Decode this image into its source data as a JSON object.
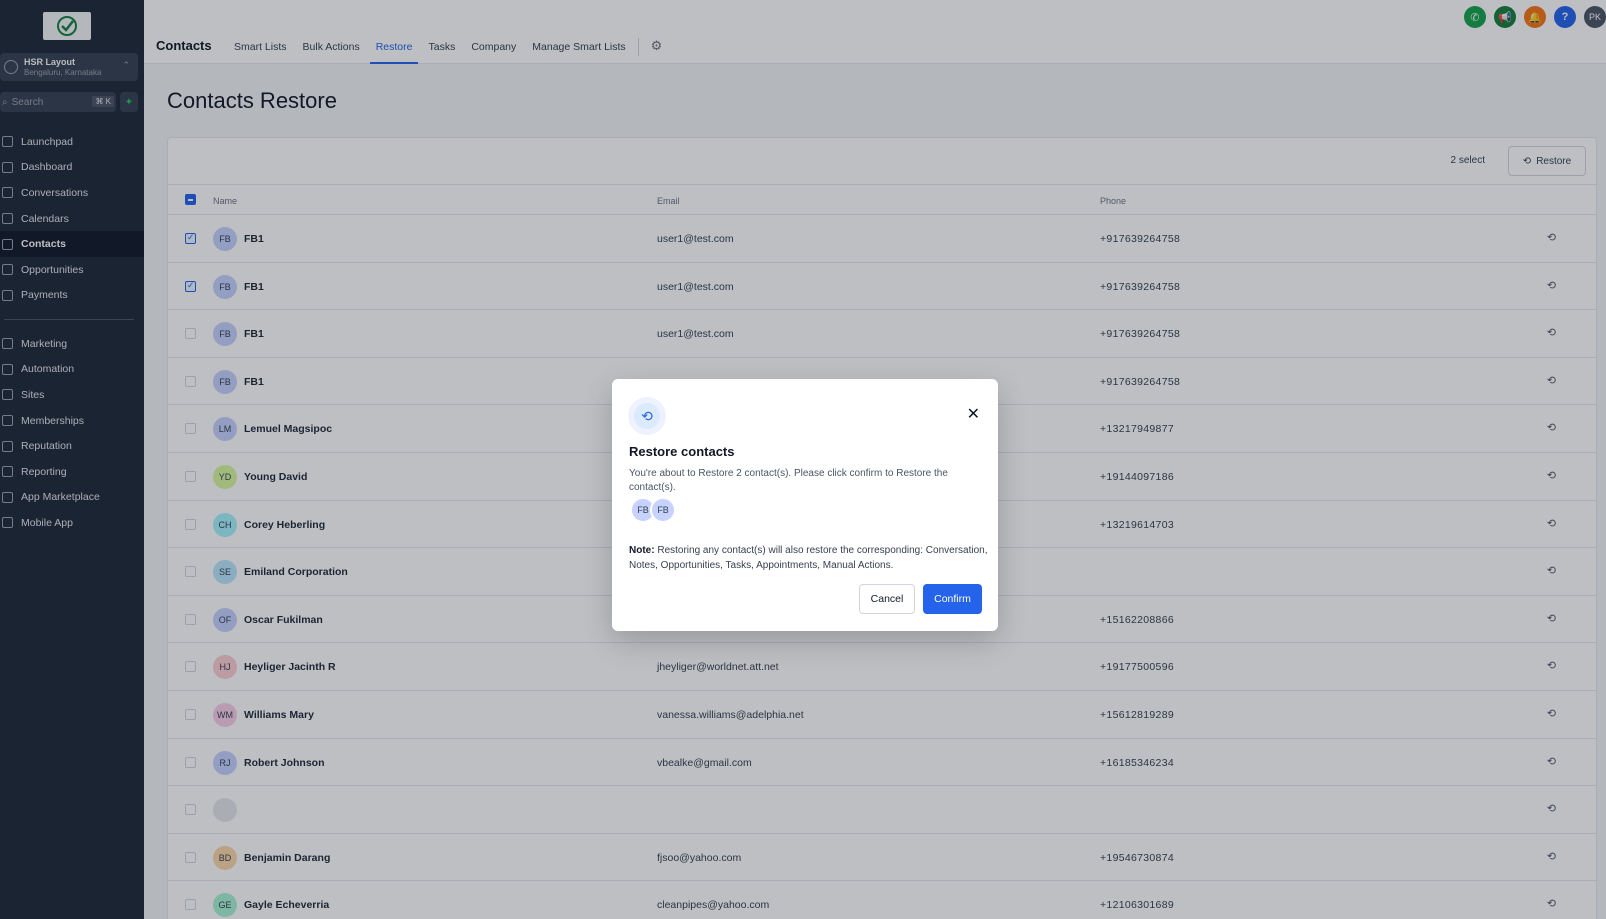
{
  "sidebar": {
    "location": {
      "name": "HSR Layout",
      "region": "Bengaluru, Karnataka"
    },
    "search": {
      "placeholder": "Search",
      "shortcut": "⌘ K"
    },
    "items_top": [
      {
        "label": "Launchpad",
        "icon": "rocket-icon"
      },
      {
        "label": "Dashboard",
        "icon": "grid-icon"
      },
      {
        "label": "Conversations",
        "icon": "chat-icon"
      },
      {
        "label": "Calendars",
        "icon": "calendar-icon"
      },
      {
        "label": "Contacts",
        "icon": "contacts-icon",
        "active": true
      },
      {
        "label": "Opportunities",
        "icon": "opportunities-icon"
      },
      {
        "label": "Payments",
        "icon": "payments-icon"
      }
    ],
    "items_bottom": [
      {
        "label": "Marketing",
        "icon": "send-icon"
      },
      {
        "label": "Automation",
        "icon": "automation-icon"
      },
      {
        "label": "Sites",
        "icon": "sites-icon"
      },
      {
        "label": "Memberships",
        "icon": "memberships-icon"
      },
      {
        "label": "Reputation",
        "icon": "star-icon"
      },
      {
        "label": "Reporting",
        "icon": "chart-icon"
      },
      {
        "label": "App Marketplace",
        "icon": "apps-icon"
      },
      {
        "label": "Mobile App",
        "icon": "phone-icon"
      }
    ]
  },
  "topbar": {
    "title": "Contacts",
    "tabs": [
      "Smart Lists",
      "Bulk Actions",
      "Restore",
      "Tasks",
      "Company",
      "Manage Smart Lists"
    ],
    "active_tab": "Restore",
    "user_initials": "PK",
    "icon_colors": {
      "phone": "#16a34a",
      "megaphone": "#15803d",
      "bell": "#f97316",
      "help": "#2563eb",
      "user": "#4b5563"
    }
  },
  "page": {
    "title": "Contacts Restore",
    "select_count": "2 select",
    "restore_label": "Restore",
    "columns": {
      "name": "Name",
      "email": "Email",
      "phone": "Phone"
    }
  },
  "rows": [
    {
      "initials": "FB",
      "name": "FB1",
      "email": "user1@test.com",
      "phone": "+917639264758",
      "checked": true,
      "color": "#c7d2fe"
    },
    {
      "initials": "FB",
      "name": "FB1",
      "email": "user1@test.com",
      "phone": "+917639264758",
      "checked": true,
      "color": "#c7d2fe"
    },
    {
      "initials": "FB",
      "name": "FB1",
      "email": "user1@test.com",
      "phone": "+917639264758",
      "checked": false,
      "color": "#c7d2fe"
    },
    {
      "initials": "FB",
      "name": "FB1",
      "email": "",
      "phone": "+917639264758",
      "checked": false,
      "color": "#c7d2fe"
    },
    {
      "initials": "LM",
      "name": "Lemuel Magsipoc",
      "email": "",
      "phone": "+13217949877",
      "checked": false,
      "color": "#c7d2fe"
    },
    {
      "initials": "YD",
      "name": "Young David",
      "email": "",
      "phone": "+19144097186",
      "checked": false,
      "color": "#d9f99d"
    },
    {
      "initials": "CH",
      "name": "Corey Heberling",
      "email": "",
      "phone": "+13219614703",
      "checked": false,
      "color": "#a5f3fc"
    },
    {
      "initials": "SE",
      "name": "Emiland Corporation",
      "email": "",
      "phone": "",
      "checked": false,
      "color": "#bae6fd"
    },
    {
      "initials": "OF",
      "name": "Oscar Fukilman",
      "email": "",
      "phone": "+15162208866",
      "checked": false,
      "color": "#c7d2fe"
    },
    {
      "initials": "HJ",
      "name": "Heyliger Jacinth R",
      "email": "jheyliger@worldnet.att.net",
      "phone": "+19177500596",
      "checked": false,
      "color": "#fecdd3"
    },
    {
      "initials": "WM",
      "name": "Williams Mary",
      "email": "vanessa.williams@adelphia.net",
      "phone": "+15612819289",
      "checked": false,
      "color": "#fbcfe8"
    },
    {
      "initials": "RJ",
      "name": "Robert Johnson",
      "email": "vbealke@gmail.com",
      "phone": "+16185346234",
      "checked": false,
      "color": "#c7d2fe"
    },
    {
      "initials": "",
      "name": "",
      "email": "",
      "phone": "",
      "checked": false,
      "color": "#e5e7eb"
    },
    {
      "initials": "BD",
      "name": "Benjamin Darang",
      "email": "fjsoo@yahoo.com",
      "phone": "+19546730874",
      "checked": false,
      "color": "#fed7aa"
    },
    {
      "initials": "GE",
      "name": "Gayle Echeverria",
      "email": "cleanpipes@yahoo.com",
      "phone": "+12106301689",
      "checked": false,
      "color": "#a7f3d0"
    }
  ],
  "modal": {
    "title": "Restore contacts",
    "message": "You're about to Restore 2 contact(s). Please click confirm to Restore the contact(s).",
    "avatars": [
      "FB",
      "FB"
    ],
    "note_label": "Note:",
    "note_text": " Restoring any contact(s) will also restore the corresponding: Conversation, Notes, Opportunities, Tasks, Appointments, Manual Actions.",
    "cancel_label": "Cancel",
    "confirm_label": "Confirm"
  }
}
